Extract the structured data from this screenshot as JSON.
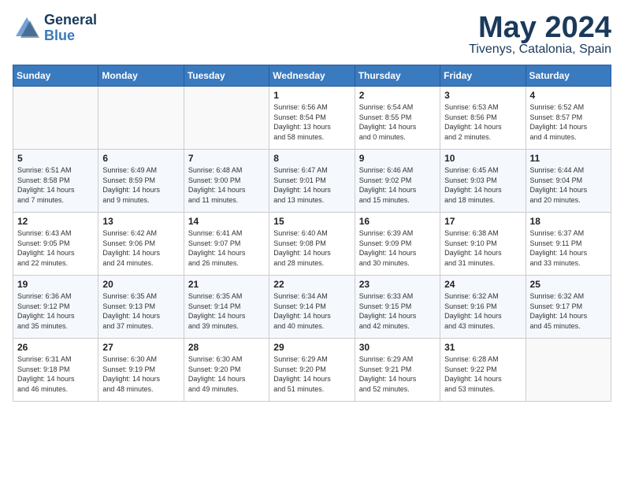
{
  "header": {
    "logo_general": "General",
    "logo_blue": "Blue",
    "month_year": "May 2024",
    "location": "Tivenys, Catalonia, Spain"
  },
  "days_of_week": [
    "Sunday",
    "Monday",
    "Tuesday",
    "Wednesday",
    "Thursday",
    "Friday",
    "Saturday"
  ],
  "weeks": [
    [
      {
        "num": "",
        "text": ""
      },
      {
        "num": "",
        "text": ""
      },
      {
        "num": "",
        "text": ""
      },
      {
        "num": "1",
        "text": "Sunrise: 6:56 AM\nSunset: 8:54 PM\nDaylight: 13 hours\nand 58 minutes."
      },
      {
        "num": "2",
        "text": "Sunrise: 6:54 AM\nSunset: 8:55 PM\nDaylight: 14 hours\nand 0 minutes."
      },
      {
        "num": "3",
        "text": "Sunrise: 6:53 AM\nSunset: 8:56 PM\nDaylight: 14 hours\nand 2 minutes."
      },
      {
        "num": "4",
        "text": "Sunrise: 6:52 AM\nSunset: 8:57 PM\nDaylight: 14 hours\nand 4 minutes."
      }
    ],
    [
      {
        "num": "5",
        "text": "Sunrise: 6:51 AM\nSunset: 8:58 PM\nDaylight: 14 hours\nand 7 minutes."
      },
      {
        "num": "6",
        "text": "Sunrise: 6:49 AM\nSunset: 8:59 PM\nDaylight: 14 hours\nand 9 minutes."
      },
      {
        "num": "7",
        "text": "Sunrise: 6:48 AM\nSunset: 9:00 PM\nDaylight: 14 hours\nand 11 minutes."
      },
      {
        "num": "8",
        "text": "Sunrise: 6:47 AM\nSunset: 9:01 PM\nDaylight: 14 hours\nand 13 minutes."
      },
      {
        "num": "9",
        "text": "Sunrise: 6:46 AM\nSunset: 9:02 PM\nDaylight: 14 hours\nand 15 minutes."
      },
      {
        "num": "10",
        "text": "Sunrise: 6:45 AM\nSunset: 9:03 PM\nDaylight: 14 hours\nand 18 minutes."
      },
      {
        "num": "11",
        "text": "Sunrise: 6:44 AM\nSunset: 9:04 PM\nDaylight: 14 hours\nand 20 minutes."
      }
    ],
    [
      {
        "num": "12",
        "text": "Sunrise: 6:43 AM\nSunset: 9:05 PM\nDaylight: 14 hours\nand 22 minutes."
      },
      {
        "num": "13",
        "text": "Sunrise: 6:42 AM\nSunset: 9:06 PM\nDaylight: 14 hours\nand 24 minutes."
      },
      {
        "num": "14",
        "text": "Sunrise: 6:41 AM\nSunset: 9:07 PM\nDaylight: 14 hours\nand 26 minutes."
      },
      {
        "num": "15",
        "text": "Sunrise: 6:40 AM\nSunset: 9:08 PM\nDaylight: 14 hours\nand 28 minutes."
      },
      {
        "num": "16",
        "text": "Sunrise: 6:39 AM\nSunset: 9:09 PM\nDaylight: 14 hours\nand 30 minutes."
      },
      {
        "num": "17",
        "text": "Sunrise: 6:38 AM\nSunset: 9:10 PM\nDaylight: 14 hours\nand 31 minutes."
      },
      {
        "num": "18",
        "text": "Sunrise: 6:37 AM\nSunset: 9:11 PM\nDaylight: 14 hours\nand 33 minutes."
      }
    ],
    [
      {
        "num": "19",
        "text": "Sunrise: 6:36 AM\nSunset: 9:12 PM\nDaylight: 14 hours\nand 35 minutes."
      },
      {
        "num": "20",
        "text": "Sunrise: 6:35 AM\nSunset: 9:13 PM\nDaylight: 14 hours\nand 37 minutes."
      },
      {
        "num": "21",
        "text": "Sunrise: 6:35 AM\nSunset: 9:14 PM\nDaylight: 14 hours\nand 39 minutes."
      },
      {
        "num": "22",
        "text": "Sunrise: 6:34 AM\nSunset: 9:14 PM\nDaylight: 14 hours\nand 40 minutes."
      },
      {
        "num": "23",
        "text": "Sunrise: 6:33 AM\nSunset: 9:15 PM\nDaylight: 14 hours\nand 42 minutes."
      },
      {
        "num": "24",
        "text": "Sunrise: 6:32 AM\nSunset: 9:16 PM\nDaylight: 14 hours\nand 43 minutes."
      },
      {
        "num": "25",
        "text": "Sunrise: 6:32 AM\nSunset: 9:17 PM\nDaylight: 14 hours\nand 45 minutes."
      }
    ],
    [
      {
        "num": "26",
        "text": "Sunrise: 6:31 AM\nSunset: 9:18 PM\nDaylight: 14 hours\nand 46 minutes."
      },
      {
        "num": "27",
        "text": "Sunrise: 6:30 AM\nSunset: 9:19 PM\nDaylight: 14 hours\nand 48 minutes."
      },
      {
        "num": "28",
        "text": "Sunrise: 6:30 AM\nSunset: 9:20 PM\nDaylight: 14 hours\nand 49 minutes."
      },
      {
        "num": "29",
        "text": "Sunrise: 6:29 AM\nSunset: 9:20 PM\nDaylight: 14 hours\nand 51 minutes."
      },
      {
        "num": "30",
        "text": "Sunrise: 6:29 AM\nSunset: 9:21 PM\nDaylight: 14 hours\nand 52 minutes."
      },
      {
        "num": "31",
        "text": "Sunrise: 6:28 AM\nSunset: 9:22 PM\nDaylight: 14 hours\nand 53 minutes."
      },
      {
        "num": "",
        "text": ""
      }
    ]
  ]
}
